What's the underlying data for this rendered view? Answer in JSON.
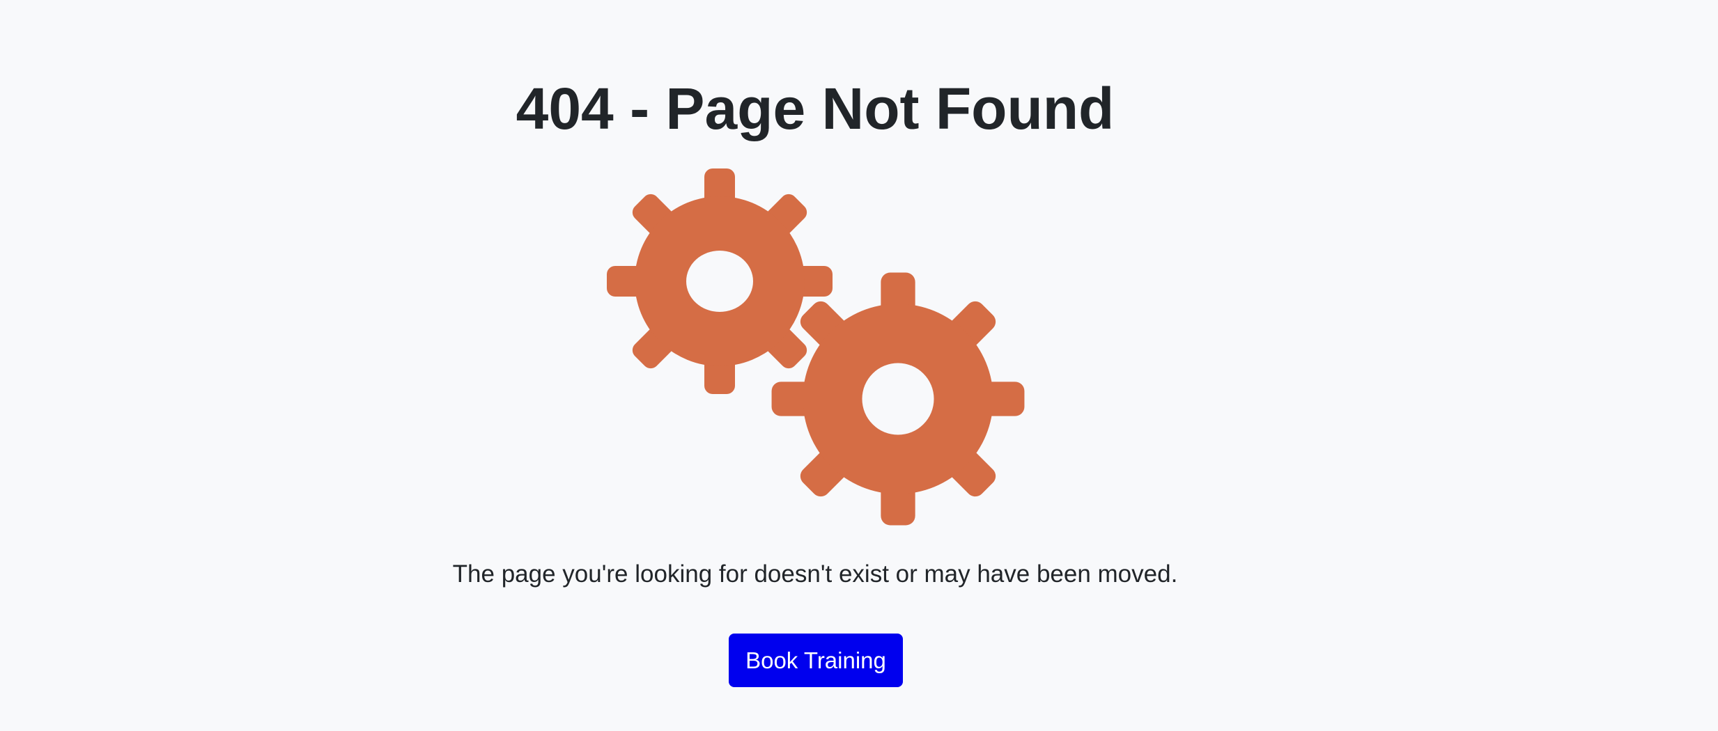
{
  "page": {
    "title": "404 - Page Not Found",
    "message": "The page you're looking for doesn't exist or may have been moved.",
    "cta_label": "Book Training"
  },
  "colors": {
    "background": "#f8f9fb",
    "text": "#212529",
    "gear": "#d56d45",
    "button": "#0000ee",
    "button_text": "#ffffff"
  },
  "icons": {
    "illustration": "gears-icon"
  }
}
